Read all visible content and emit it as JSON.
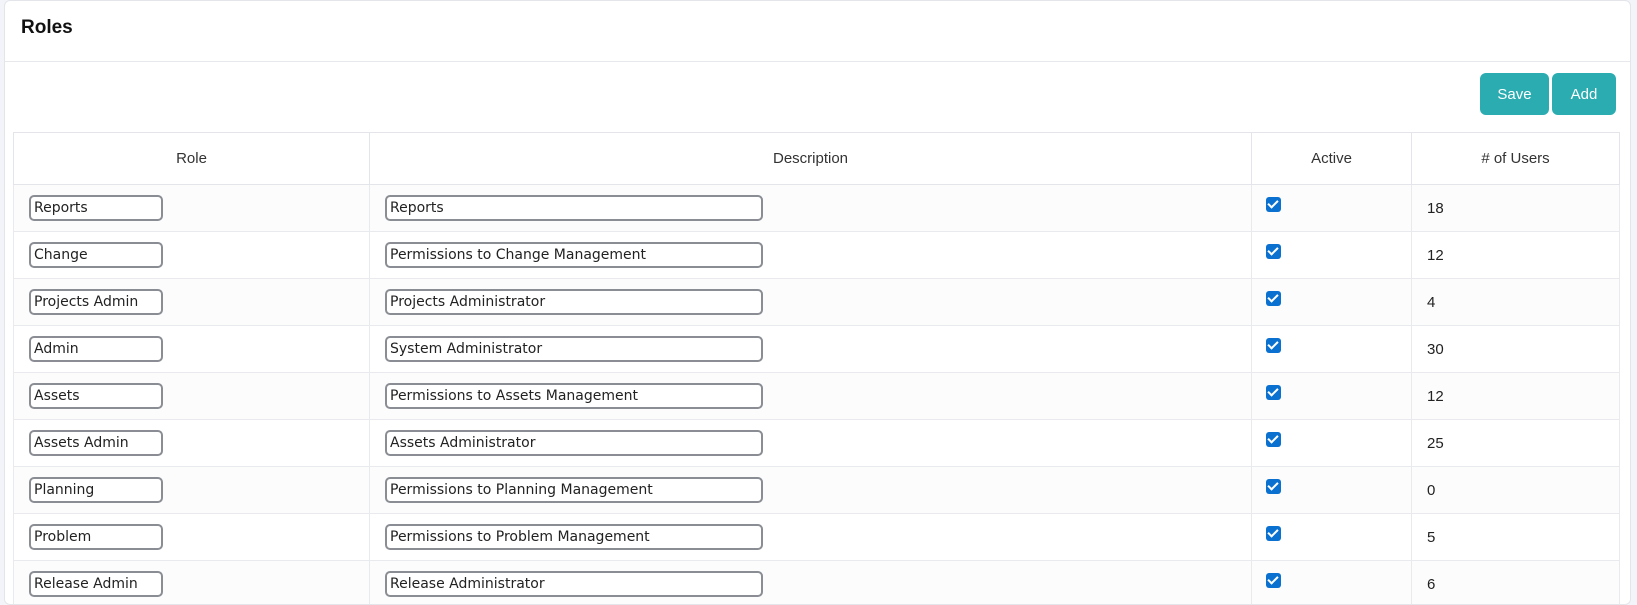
{
  "page": {
    "title": "Roles"
  },
  "toolbar": {
    "save_label": "Save",
    "add_label": "Add",
    "button_color": "#2aacb0"
  },
  "table": {
    "columns": [
      "Role",
      "Description",
      "Active",
      "# of Users"
    ],
    "rows": [
      {
        "role": "Reports",
        "description": "Reports",
        "active": true,
        "users": "18"
      },
      {
        "role": "Change",
        "description": "Permissions to Change Management",
        "active": true,
        "users": "12"
      },
      {
        "role": "Projects Admin",
        "description": "Projects Administrator",
        "active": true,
        "users": "4"
      },
      {
        "role": "Admin",
        "description": "System Administrator",
        "active": true,
        "users": "30"
      },
      {
        "role": "Assets",
        "description": "Permissions to Assets Management",
        "active": true,
        "users": "12"
      },
      {
        "role": "Assets Admin",
        "description": "Assets Administrator",
        "active": true,
        "users": "25"
      },
      {
        "role": "Planning",
        "description": "Permissions to Planning Management",
        "active": true,
        "users": "0"
      },
      {
        "role": "Problem",
        "description": "Permissions to Problem Management",
        "active": true,
        "users": "5"
      },
      {
        "role": "Release Admin",
        "description": "Release Administrator",
        "active": true,
        "users": "6"
      }
    ]
  },
  "colors": {
    "checkbox": "#0b71d0",
    "accent": "#2aacb0"
  }
}
